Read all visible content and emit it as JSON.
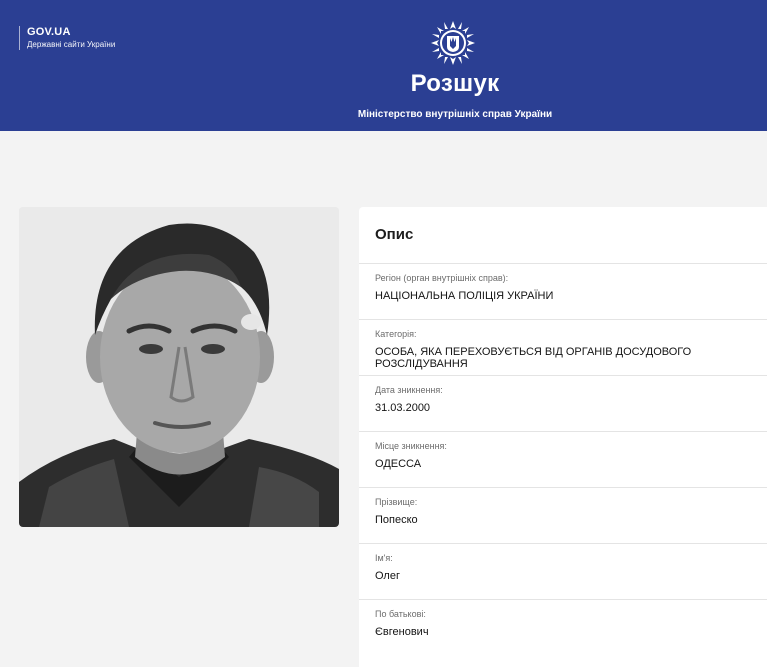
{
  "header": {
    "gov_title": "GOV.UA",
    "gov_subtitle": "Державні сайти України",
    "emblem_icon": "police-emblem-icon",
    "title": "Розшук",
    "subtitle": "Міністерство внутрішніх справ України",
    "background_color": "#2b3f93"
  },
  "photo": {
    "description_icon": "person-photo"
  },
  "card": {
    "title": "Опис",
    "fields": [
      {
        "label": "Регіон (орган внутрішніх справ):",
        "value": "НАЦІОНАЛЬНА ПОЛІЦІЯ УКРАЇНИ"
      },
      {
        "label": "Категорія:",
        "value": "ОСОБА, ЯКА ПЕРЕХОВУЄТЬСЯ ВІД ОРГАНІВ ДОСУДОВОГО РОЗСЛІДУВАННЯ"
      },
      {
        "label": "Дата зникнення:",
        "value": "31.03.2000"
      },
      {
        "label": "Місце зникнення:",
        "value": "ОДЕССА"
      },
      {
        "label": "Прізвище:",
        "value": "Попеско"
      },
      {
        "label": "Ім'я:",
        "value": "Олег"
      },
      {
        "label": "По батькові:",
        "value": "Євгенович"
      }
    ]
  }
}
